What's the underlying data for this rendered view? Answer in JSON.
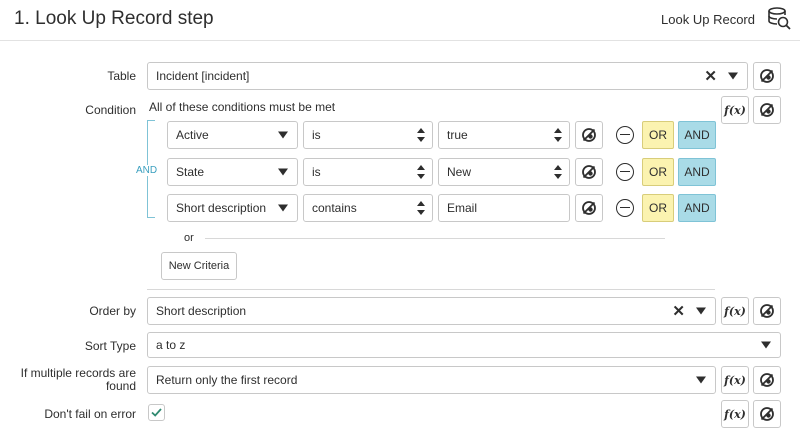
{
  "header": {
    "title": "1.   Look Up Record step",
    "type_label": "Look Up Record",
    "type_icon": "database-search-icon"
  },
  "table": {
    "label": "Table",
    "value": "Incident [incident]"
  },
  "condition": {
    "label": "Condition",
    "description": "All of these conditions must be met",
    "group_operator": "AND",
    "rows": [
      {
        "field": "Active",
        "operator": "is",
        "value": "true",
        "value_type": "select"
      },
      {
        "field": "State",
        "operator": "is",
        "value": "New",
        "value_type": "select"
      },
      {
        "field": "Short description",
        "operator": "contains",
        "value": "Email",
        "value_type": "text"
      }
    ],
    "or_label": "OR",
    "and_label": "AND",
    "or_separator": "or",
    "new_criteria_label": "New Criteria"
  },
  "order_by": {
    "label": "Order by",
    "value": "Short description"
  },
  "sort_type": {
    "label": "Sort Type",
    "value": "a to z"
  },
  "multiple": {
    "label_line1": "If multiple records are",
    "label_line2": "found",
    "value": "Return only the first record"
  },
  "dont_fail": {
    "label": "Don't fail on error",
    "checked": true
  },
  "fx_label": "f(x)",
  "colors": {
    "or_bg": "#fbf3b0",
    "and_bg": "#a9dbe7",
    "bracket": "#7fc3d6",
    "checkmark": "#2f8a70"
  }
}
